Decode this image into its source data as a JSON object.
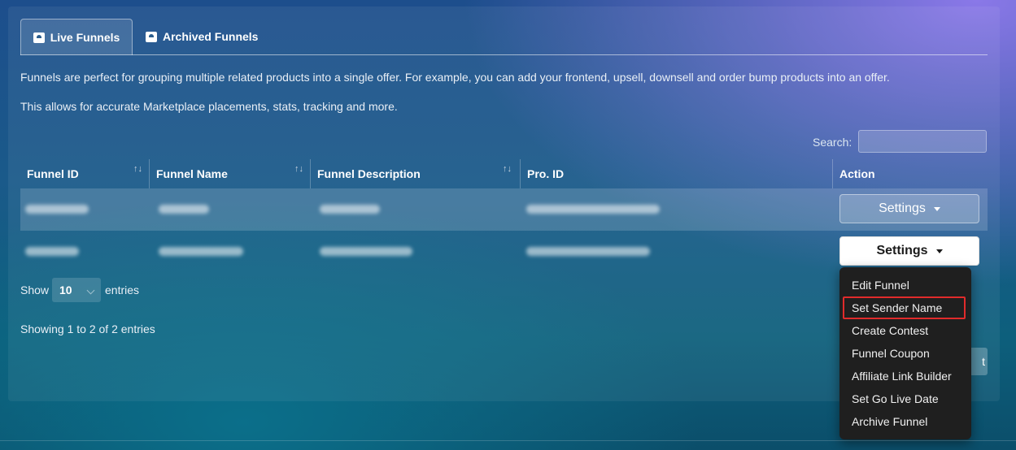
{
  "tabs": {
    "live": "Live Funnels",
    "archived": "Archived Funnels"
  },
  "description": {
    "line1": "Funnels are perfect for grouping multiple related products into a single offer. For example, you can add your frontend, upsell, downsell and order bump products into an offer.",
    "line2": "This allows for accurate Marketplace placements, stats, tracking and more."
  },
  "search": {
    "label": "Search:",
    "value": ""
  },
  "table": {
    "headers": {
      "funnel_id": "Funnel ID",
      "funnel_name": "Funnel Name",
      "funnel_description": "Funnel Description",
      "pro_id": "Pro. ID",
      "action": "Action"
    },
    "sort_icon": "sort-arrows-icon",
    "settings_label": "Settings"
  },
  "length": {
    "show": "Show",
    "value": "10",
    "entries": "entries"
  },
  "info": "Showing 1 to 2 of 2 entries",
  "pagination": {
    "next_partial": "t"
  },
  "menu": {
    "items": [
      "Edit Funnel",
      "Set Sender Name",
      "Create Contest",
      "Funnel Coupon",
      "Affiliate Link Builder",
      "Set Go Live Date",
      "Archive Funnel"
    ],
    "highlighted": "Set Sender Name",
    "highlight_color": "#e12b2b"
  }
}
